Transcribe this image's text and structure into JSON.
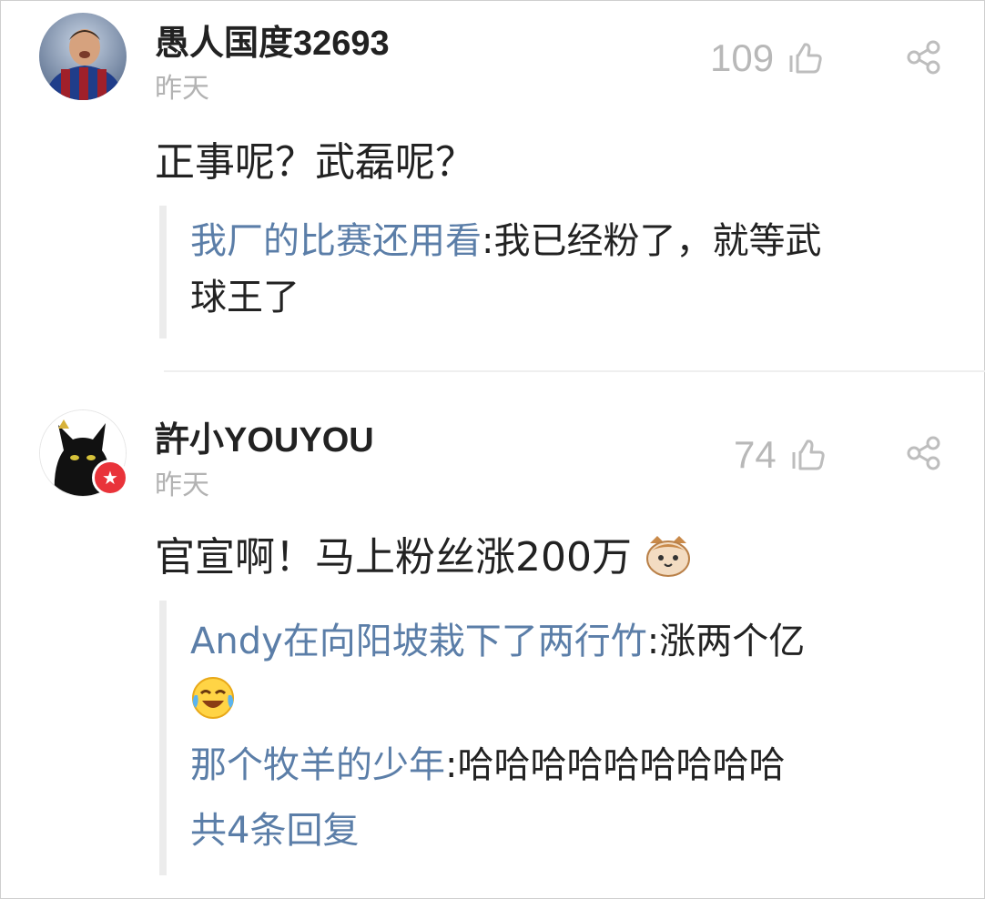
{
  "comments": [
    {
      "username": "愚人国度32693",
      "time": "昨天",
      "likes": "109",
      "content": "正事呢？武磊呢？",
      "replies": [
        {
          "name": "我厂的比赛还用看",
          "text": ":我已经粉了，就等武",
          "text2": "球王了"
        }
      ]
    },
    {
      "username": "許小YOUYOU",
      "time": "昨天",
      "likes": "74",
      "content": "官宣啊！马上粉丝涨200万",
      "content_emoji": "cat-face-emoji",
      "replies": [
        {
          "name": "Andy在向阳坡栽下了两行竹",
          "text": ":涨两个亿",
          "emoji": "laughing-crying-emoji"
        },
        {
          "name": "那个牧羊的少年",
          "text": ":哈哈哈哈哈哈哈哈哈"
        }
      ],
      "more_replies": "共4条回复"
    }
  ],
  "icons": {
    "like": "thumbs-up-outline-icon",
    "share": "share-icon",
    "badge": "star-badge-icon"
  },
  "colors": {
    "link": "#5b7ea8",
    "muted": "#b3b3b3",
    "badge": "#e9333a"
  }
}
